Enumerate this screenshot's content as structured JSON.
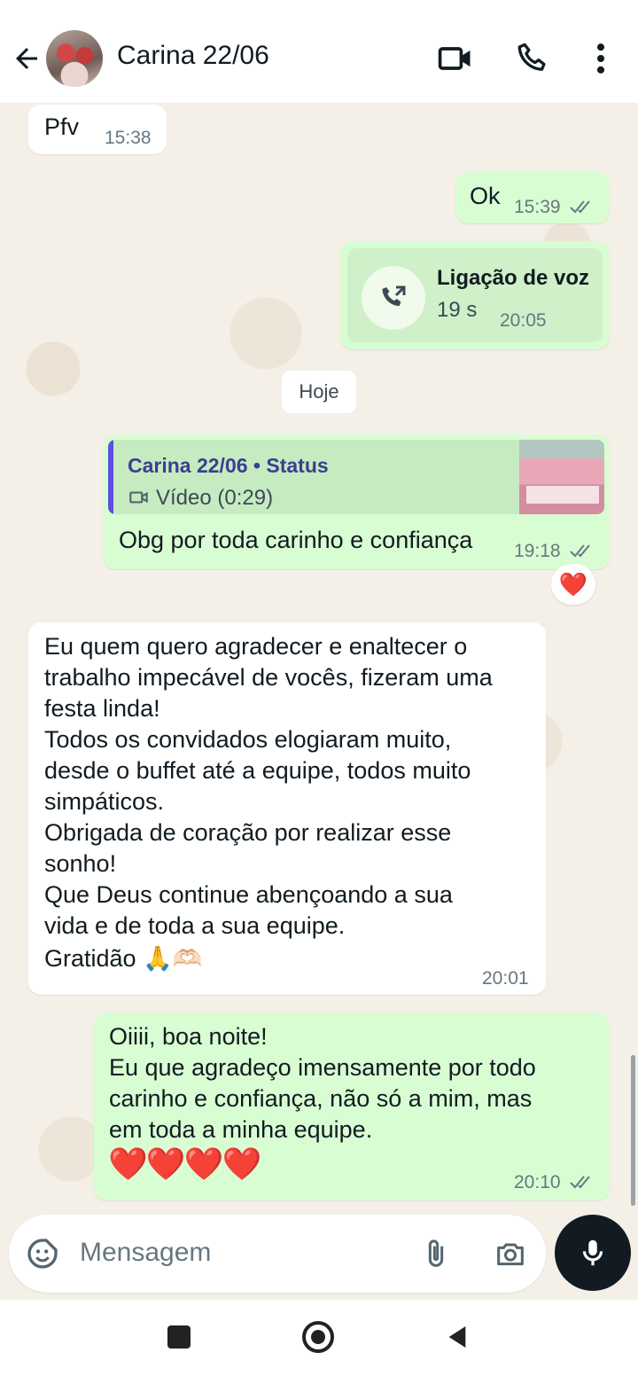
{
  "header": {
    "contact_name": "Carina 22/06"
  },
  "messages": {
    "m1": {
      "text": "Pfv",
      "time": "15:38"
    },
    "m2": {
      "text": "Ok",
      "time": "15:39"
    },
    "m3": {
      "title": "Ligação de voz",
      "duration": "19 s",
      "time": "20:05"
    },
    "day_divider": "Hoje",
    "m4": {
      "quote_author": "Carina 22/06 • Status",
      "quote_media": "Vídeo (0:29)",
      "text": "Obg por toda carinho e confiança",
      "time": "19:18",
      "reaction": "❤️"
    },
    "m5": {
      "text": "Eu quem quero agradecer e enaltecer o\ntrabalho impecável de vocês, fizeram uma\nfesta linda!\nTodos os convidados elogiaram muito,\ndesde o buffet até a equipe, todos muito\nsimpáticos.\nObrigada de coração por realizar esse\nsonho!\nQue Deus continue abençoando a sua\nvida e de toda a sua equipe.",
      "last_line": "Gratidão 🙏🫶🏻",
      "time": "20:01"
    },
    "m6": {
      "text": "Oiiii, boa noite!\nEu que agradeço imensamente por todo\ncarinho e confiança, não só a mim, mas\nem toda a minha equipe.",
      "hearts": "❤️❤️❤️❤️",
      "time": "20:10"
    }
  },
  "composer": {
    "placeholder": "Mensagem"
  },
  "icons": {
    "back": "arrow-left-icon",
    "video": "video-call-icon",
    "phone": "phone-icon",
    "menu": "more-vertical-icon",
    "emoji": "sticker-icon",
    "attach": "paperclip-icon",
    "camera": "camera-icon",
    "mic": "microphone-icon"
  },
  "colors": {
    "outgoing_bubble": "#d9fdd3",
    "incoming_bubble": "#ffffff",
    "read_ticks": "#667781",
    "quote_bar": "#5b4fe0"
  }
}
